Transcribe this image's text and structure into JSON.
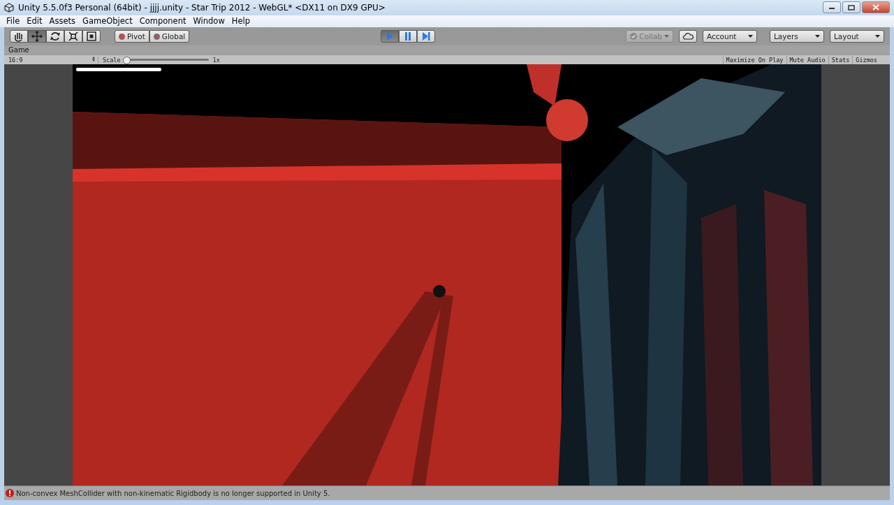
{
  "window": {
    "title": "Unity 5.5.0f3 Personal (64bit) - jjjj.unity - Star Trip 2012 - WebGL* <DX11 on DX9 GPU>"
  },
  "menu": [
    "File",
    "Edit",
    "Assets",
    "GameObject",
    "Component",
    "Window",
    "Help"
  ],
  "tools": [
    {
      "kind": "hand",
      "selected": false
    },
    {
      "kind": "move",
      "selected": true
    },
    {
      "kind": "rotate",
      "selected": false
    },
    {
      "kind": "scale",
      "selected": false
    },
    {
      "kind": "rect",
      "selected": false
    }
  ],
  "handles": [
    {
      "kind": "pivot",
      "label": "Pivot"
    },
    {
      "kind": "global",
      "label": "Global"
    }
  ],
  "playback": [
    {
      "kind": "play",
      "selected": true
    },
    {
      "kind": "pause",
      "selected": false
    },
    {
      "kind": "step",
      "selected": false
    }
  ],
  "collab": {
    "label": "Collab",
    "disabled": true
  },
  "dropdowns": [
    "Account",
    "Layers",
    "Layout"
  ],
  "game": {
    "tab": "Game",
    "aspect": "16:9",
    "scale_label": "Scale",
    "scale": {
      "level": 0.0
    },
    "scale_value": "1x",
    "toggles": [
      {
        "label": "Maximize On Play",
        "on": false
      },
      {
        "label": "Mute Audio",
        "on": false
      },
      {
        "label": "Stats",
        "on": false
      },
      {
        "label": "Gizmos",
        "on": false
      }
    ]
  },
  "status_bar": {
    "kind": "error",
    "message": "Non-convex MeshCollider with non-kinematic Rigidbody is no longer supported in Unity 5."
  }
}
